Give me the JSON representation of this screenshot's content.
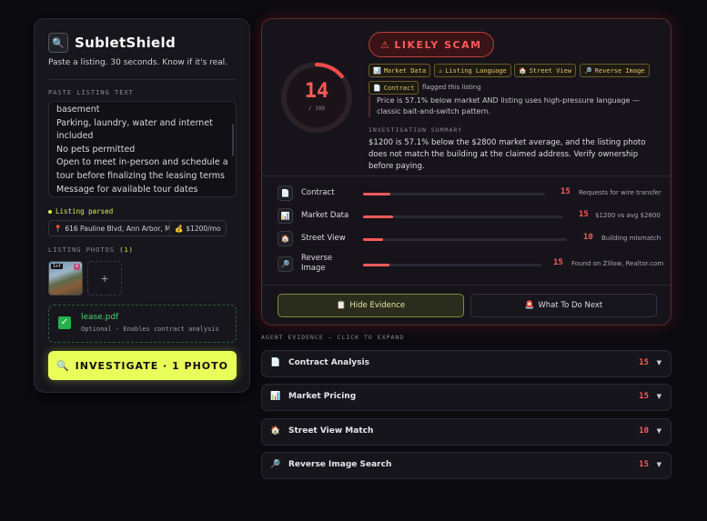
{
  "brand": {
    "name": "SubletShield",
    "logo_icon": "🔍",
    "tagline": "Paste a listing. 30 seconds. Know if it's real."
  },
  "listing": {
    "label": "PASTE LISTING TEXT",
    "lines": [
      "basement",
      "Parking, laundry, water and internet",
      "included",
      "No pets permitted",
      "Open to meet in-person and schedule a",
      "tour before finalizing the leasing terms",
      "Message for available tour dates"
    ]
  },
  "parsed": {
    "label": "Listing parsed",
    "address": "616 Pauline Blvd, Ann Arbor, MI",
    "address_icon": "📍",
    "price": "$1200/mo",
    "price_icon": "💰"
  },
  "photos": {
    "label": "LISTING PHOTOS",
    "count": "(1)",
    "first_tag": "1st",
    "remove": "×",
    "add": "+"
  },
  "pdf": {
    "name": "lease.pdf",
    "hint": "Optional · Enables contract analysis",
    "check": "✓"
  },
  "investigate": {
    "icon": "🔍",
    "label": "INVESTIGATE · 1 PHOTO"
  },
  "verdict": {
    "score": "14",
    "score_max": "/ 100",
    "score_fraction": 0.14,
    "badge_icon": "⚠",
    "badge": "LIKELY SCAM",
    "agents": [
      {
        "icon": "📊",
        "label": "Market Data"
      },
      {
        "icon": "⚠",
        "label": "Listing Language"
      },
      {
        "icon": "🏠",
        "label": "Street View"
      },
      {
        "icon": "🔎",
        "label": "Reverse Image"
      },
      {
        "icon": "📄",
        "label": "Contract"
      }
    ],
    "flagged_text": "flagged this listing",
    "quote": "Price is 57.1% below market AND listing uses high-pressure language — classic bait-and-switch pattern.",
    "summary_label": "INVESTIGATION SUMMARY",
    "summary": "$1200 is 57.1% below the $2800 market average, and the listing photo does not match the building at the claimed address. Verify ownership before paying."
  },
  "scores": [
    {
      "icon": "📄",
      "label": "Contract",
      "score": "15",
      "fraction": 0.15,
      "note": "Requests for wire transfer"
    },
    {
      "icon": "📊",
      "label": "Market Data",
      "score": "15",
      "fraction": 0.15,
      "note": "$1200 vs avg $2800"
    },
    {
      "icon": "🏠",
      "label": "Street View",
      "score": "10",
      "fraction": 0.1,
      "note": "Building mismatch"
    },
    {
      "icon": "🔎",
      "label": "Reverse Image",
      "score": "15",
      "fraction": 0.15,
      "note": "Found on Zillow, Realtor.com"
    }
  ],
  "actions": {
    "hide_icon": "📋",
    "hide": "Hide Evidence",
    "next_icon": "🚨",
    "next": "What To Do Next"
  },
  "evidence": {
    "label": "AGENT EVIDENCE — CLICK TO EXPAND",
    "items": [
      {
        "icon": "📄",
        "title": "Contract Analysis",
        "score": "15"
      },
      {
        "icon": "📊",
        "title": "Market Pricing",
        "score": "15"
      },
      {
        "icon": "🏠",
        "title": "Street View Match",
        "score": "10"
      },
      {
        "icon": "🔎",
        "title": "Reverse Image Search",
        "score": "15"
      }
    ],
    "chevron": "▼"
  },
  "colors": {
    "accent": "#e8ff5a",
    "danger": "#ff5a5a",
    "success": "#22b24c",
    "warning": "#e3c36a"
  }
}
